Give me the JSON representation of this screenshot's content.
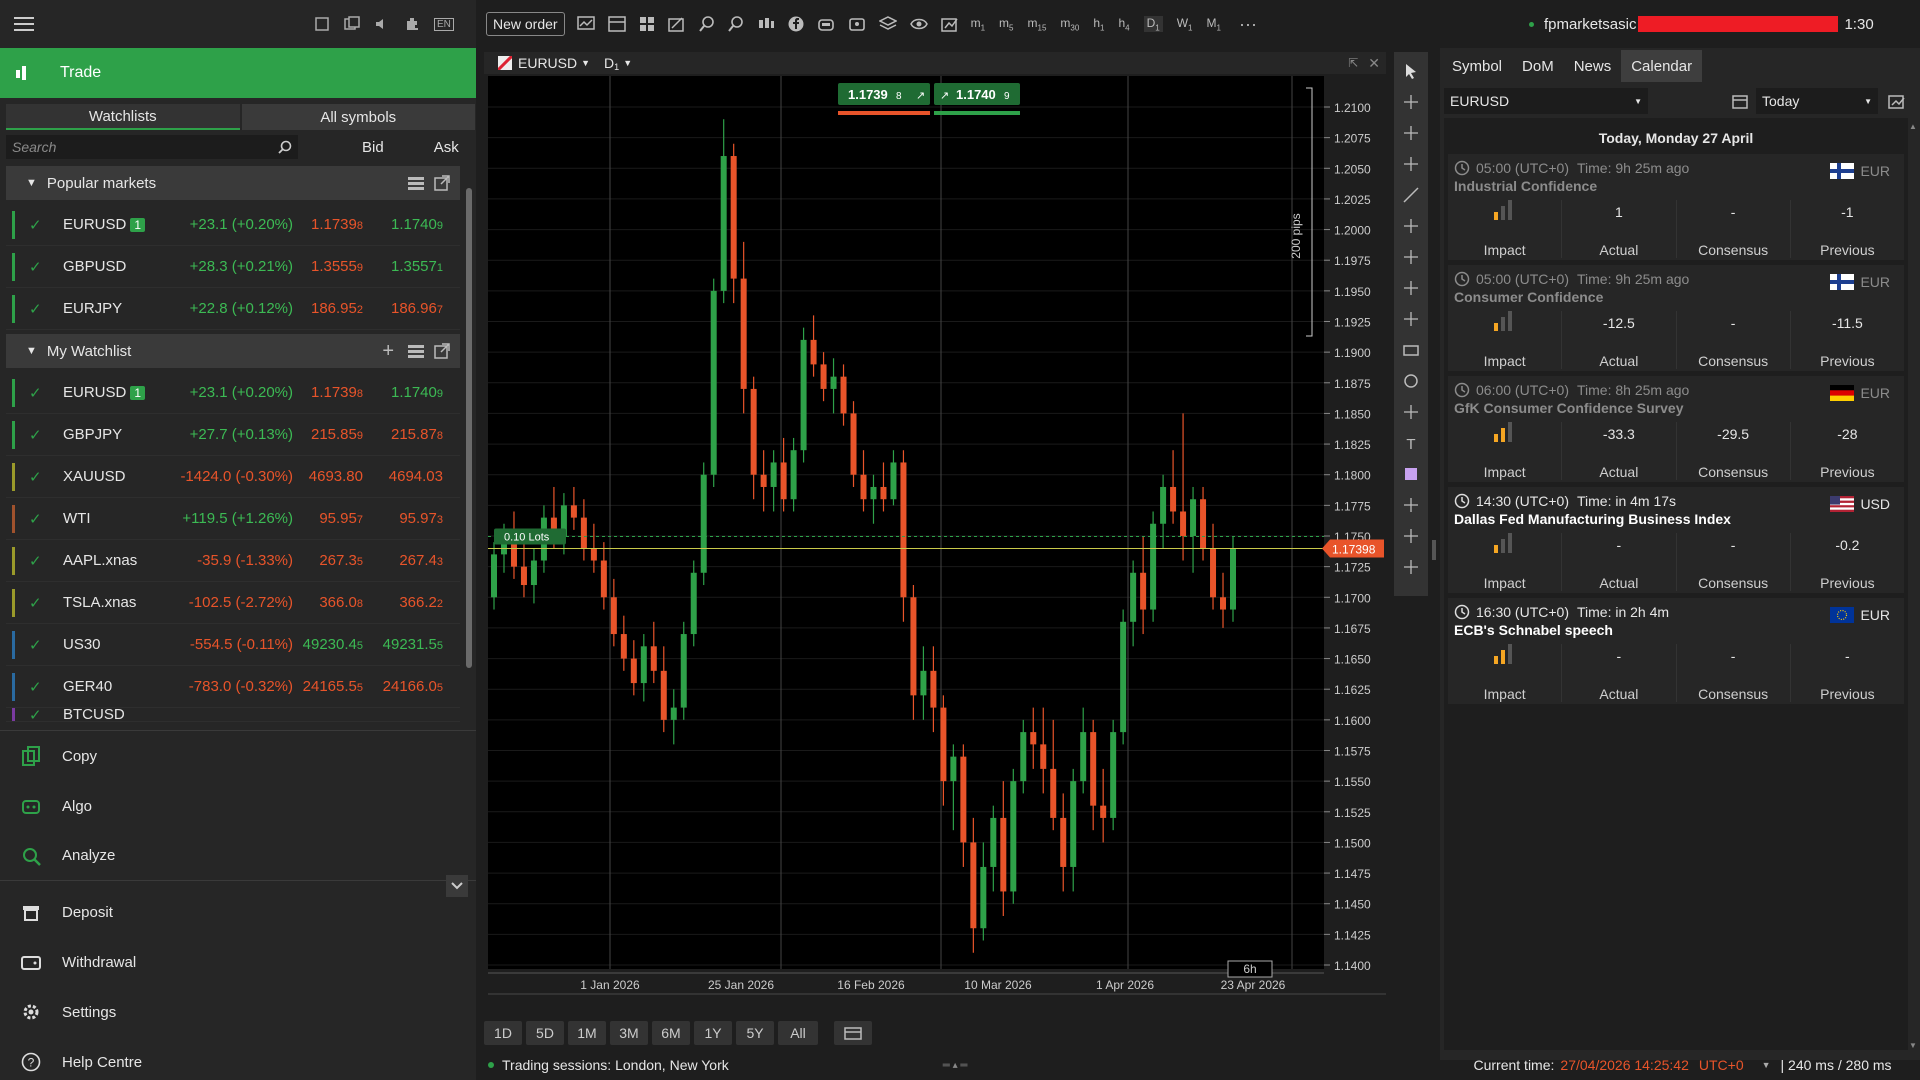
{
  "toolbar": {
    "new_order": "New order",
    "timeframes": [
      "m1",
      "m5",
      "m15",
      "m30",
      "h1",
      "h4",
      "D1",
      "W1",
      "M1"
    ],
    "user": "fpmarketsasic",
    "time": "1:30",
    "more": "···",
    "lang": "EN"
  },
  "left": {
    "trade": "Trade",
    "tab_watchlists": "Watchlists",
    "tab_all": "All symbols",
    "search_placeholder": "Search",
    "col_bid": "Bid",
    "col_ask": "Ask",
    "popular_title": "Popular markets",
    "mywatch_title": "My Watchlist",
    "popular": [
      {
        "sym": "EURUSD",
        "badge": "1",
        "chg": "+23.1 (+0.20%)",
        "bid": "1.1739",
        "bid_s": "8",
        "ask": "1.1740",
        "ask_s": "9",
        "dir": "up",
        "bar": "#2ea149",
        "bidc": "dn",
        "askc": "up"
      },
      {
        "sym": "GBPUSD",
        "badge": "",
        "chg": "+28.3 (+0.21%)",
        "bid": "1.3555",
        "bid_s": "9",
        "ask": "1.3557",
        "ask_s": "1",
        "dir": "up",
        "bar": "#2ea149",
        "bidc": "dn",
        "askc": "up"
      },
      {
        "sym": "EURJPY",
        "badge": "",
        "chg": "+22.8 (+0.12%)",
        "bid": "186.95",
        "bid_s": "2",
        "ask": "186.96",
        "ask_s": "7",
        "dir": "up",
        "bar": "#2ea149",
        "bidc": "dn",
        "askc": "dn"
      }
    ],
    "watch": [
      {
        "sym": "EURUSD",
        "badge": "1",
        "chg": "+23.1 (+0.20%)",
        "bid": "1.1739",
        "bid_s": "8",
        "ask": "1.1740",
        "ask_s": "9",
        "dir": "up",
        "bar": "#2ea149",
        "bidc": "dn",
        "askc": "up"
      },
      {
        "sym": "GBPJPY",
        "badge": "",
        "chg": "+27.7 (+0.13%)",
        "bid": "215.85",
        "bid_s": "9",
        "ask": "215.87",
        "ask_s": "8",
        "dir": "up",
        "bar": "#2ea149",
        "bidc": "dn",
        "askc": "dn"
      },
      {
        "sym": "XAUUSD",
        "badge": "",
        "chg": "-1424.0 (-0.30%)",
        "bid": "4693.80",
        "bid_s": "",
        "ask": "4694.03",
        "ask_s": "",
        "dir": "dn",
        "bar": "#9a9a2a",
        "bidc": "dn",
        "askc": "dn"
      },
      {
        "sym": "WTI",
        "badge": "",
        "chg": "+119.5 (+1.26%)",
        "bid": "95.95",
        "bid_s": "7",
        "ask": "95.97",
        "ask_s": "3",
        "dir": "up",
        "bar": "#a0522d",
        "bidc": "dn",
        "askc": "dn"
      },
      {
        "sym": "AAPL.xnas",
        "badge": "",
        "chg": "-35.9 (-1.33%)",
        "bid": "267.3",
        "bid_s": "5",
        "ask": "267.4",
        "ask_s": "3",
        "dir": "dn",
        "bar": "#9a9a2a",
        "bidc": "dn",
        "askc": "dn"
      },
      {
        "sym": "TSLA.xnas",
        "badge": "",
        "chg": "-102.5 (-2.72%)",
        "bid": "366.0",
        "bid_s": "8",
        "ask": "366.2",
        "ask_s": "2",
        "dir": "dn",
        "bar": "#9a9a2a",
        "bidc": "dn",
        "askc": "dn"
      },
      {
        "sym": "US30",
        "badge": "",
        "chg": "-554.5 (-0.11%)",
        "bid": "49230.4",
        "bid_s": "5",
        "ask": "49231.5",
        "ask_s": "5",
        "dir": "dn",
        "bar": "#2a6aa0",
        "bidc": "up",
        "askc": "up"
      },
      {
        "sym": "GER40",
        "badge": "",
        "chg": "-783.0 (-0.32%)",
        "bid": "24165.5",
        "bid_s": "5",
        "ask": "24166.0",
        "ask_s": "5",
        "dir": "dn",
        "bar": "#2a6aa0",
        "bidc": "dn",
        "askc": "dn"
      },
      {
        "sym": "BTCUSD",
        "badge": "",
        "chg": "",
        "bid": "",
        "bid_s": "",
        "ask": "",
        "ask_s": "",
        "dir": "up",
        "bar": "#7a3aa0",
        "bidc": "dn",
        "askc": "up"
      }
    ],
    "nav": [
      {
        "id": "copy",
        "label": "Copy",
        "icon": "copy-icon"
      },
      {
        "id": "algo",
        "label": "Algo",
        "icon": "robot-icon"
      },
      {
        "id": "analyze",
        "label": "Analyze",
        "icon": "analyze-icon"
      },
      {
        "id": "deposit",
        "label": "Deposit",
        "icon": "deposit-icon"
      },
      {
        "id": "withdrawal",
        "label": "Withdrawal",
        "icon": "wallet-icon"
      },
      {
        "id": "settings",
        "label": "Settings",
        "icon": "gear-icon"
      },
      {
        "id": "help",
        "label": "Help Centre",
        "icon": "help-icon"
      }
    ]
  },
  "chart": {
    "symbol": "EURUSD",
    "timeframe": "D",
    "timeframe_sub": "1",
    "sell_price": "1.1739",
    "sell_sub": "8",
    "buy_price": "1.1740",
    "buy_sub": "9",
    "pips_label": "200 pips",
    "lots_label": "0.10 Lots",
    "current_price": "1.17398",
    "countdown": "6h",
    "y_ticks": [
      "1.2100",
      "1.2075",
      "1.2050",
      "1.2025",
      "1.2000",
      "1.1975",
      "1.1950",
      "1.1925",
      "1.1900",
      "1.1875",
      "1.1850",
      "1.1825",
      "1.1800",
      "1.1775",
      "1.1750",
      "1.1725",
      "1.1700",
      "1.1675",
      "1.1650",
      "1.1625",
      "1.1600",
      "1.1575",
      "1.1550",
      "1.1525",
      "1.1500",
      "1.1475",
      "1.1450",
      "1.1425",
      "1.1400"
    ],
    "x_ticks": [
      "1 Jan 2026",
      "25 Jan 2026",
      "16 Feb 2026",
      "10 Mar 2026",
      "1 Apr 2026",
      "23 Apr 2026"
    ],
    "ranges": [
      "1D",
      "5D",
      "1M",
      "3M",
      "6M",
      "1Y",
      "5Y",
      "All"
    ],
    "sessions": "Trading sessions: London, New York"
  },
  "chart_data": {
    "type": "candlestick",
    "title": "EURUSD D1",
    "ylim": [
      1.14,
      1.21
    ],
    "candles": [
      [
        1.17,
        1.1745,
        1.169,
        1.1735
      ],
      [
        1.1735,
        1.176,
        1.172,
        1.1745
      ],
      [
        1.1745,
        1.177,
        1.1715,
        1.1725
      ],
      [
        1.1725,
        1.175,
        1.17,
        1.171
      ],
      [
        1.171,
        1.174,
        1.1695,
        1.173
      ],
      [
        1.173,
        1.1775,
        1.172,
        1.1765
      ],
      [
        1.1765,
        1.179,
        1.174,
        1.175
      ],
      [
        1.175,
        1.1785,
        1.1735,
        1.1775
      ],
      [
        1.1775,
        1.179,
        1.1755,
        1.1765
      ],
      [
        1.1765,
        1.178,
        1.173,
        1.174
      ],
      [
        1.174,
        1.176,
        1.172,
        1.173
      ],
      [
        1.173,
        1.1745,
        1.169,
        1.17
      ],
      [
        1.17,
        1.1715,
        1.166,
        1.167
      ],
      [
        1.167,
        1.1685,
        1.164,
        1.165
      ],
      [
        1.165,
        1.1665,
        1.162,
        1.163
      ],
      [
        1.163,
        1.167,
        1.1615,
        1.166
      ],
      [
        1.166,
        1.168,
        1.163,
        1.164
      ],
      [
        1.164,
        1.166,
        1.159,
        1.16
      ],
      [
        1.16,
        1.1625,
        1.158,
        1.161
      ],
      [
        1.161,
        1.168,
        1.16,
        1.167
      ],
      [
        1.167,
        1.173,
        1.166,
        1.172
      ],
      [
        1.172,
        1.181,
        1.171,
        1.18
      ],
      [
        1.18,
        1.196,
        1.179,
        1.195
      ],
      [
        1.195,
        1.209,
        1.194,
        1.206
      ],
      [
        1.206,
        1.207,
        1.194,
        1.196
      ],
      [
        1.196,
        1.199,
        1.185,
        1.187
      ],
      [
        1.187,
        1.188,
        1.178,
        1.18
      ],
      [
        1.18,
        1.182,
        1.177,
        1.179
      ],
      [
        1.179,
        1.182,
        1.177,
        1.181
      ],
      [
        1.181,
        1.183,
        1.177,
        1.178
      ],
      [
        1.178,
        1.183,
        1.177,
        1.182
      ],
      [
        1.182,
        1.192,
        1.181,
        1.191
      ],
      [
        1.191,
        1.193,
        1.188,
        1.189
      ],
      [
        1.189,
        1.19,
        1.186,
        1.187
      ],
      [
        1.187,
        1.1895,
        1.185,
        1.188
      ],
      [
        1.188,
        1.189,
        1.184,
        1.185
      ],
      [
        1.185,
        1.186,
        1.179,
        1.18
      ],
      [
        1.18,
        1.182,
        1.177,
        1.178
      ],
      [
        1.178,
        1.18,
        1.176,
        1.179
      ],
      [
        1.179,
        1.181,
        1.177,
        1.178
      ],
      [
        1.178,
        1.182,
        1.1775,
        1.181
      ],
      [
        1.181,
        1.182,
        1.168,
        1.17
      ],
      [
        1.17,
        1.171,
        1.16,
        1.162
      ],
      [
        1.162,
        1.166,
        1.16,
        1.164
      ],
      [
        1.164,
        1.166,
        1.159,
        1.161
      ],
      [
        1.161,
        1.162,
        1.153,
        1.155
      ],
      [
        1.155,
        1.158,
        1.151,
        1.157
      ],
      [
        1.157,
        1.158,
        1.148,
        1.15
      ],
      [
        1.15,
        1.152,
        1.141,
        1.143
      ],
      [
        1.143,
        1.15,
        1.142,
        1.148
      ],
      [
        1.148,
        1.153,
        1.146,
        1.152
      ],
      [
        1.152,
        1.155,
        1.144,
        1.146
      ],
      [
        1.146,
        1.156,
        1.145,
        1.155
      ],
      [
        1.155,
        1.16,
        1.154,
        1.159
      ],
      [
        1.159,
        1.161,
        1.156,
        1.158
      ],
      [
        1.158,
        1.161,
        1.154,
        1.156
      ],
      [
        1.156,
        1.16,
        1.151,
        1.152
      ],
      [
        1.152,
        1.154,
        1.146,
        1.148
      ],
      [
        1.148,
        1.156,
        1.146,
        1.155
      ],
      [
        1.155,
        1.161,
        1.154,
        1.159
      ],
      [
        1.159,
        1.16,
        1.151,
        1.153
      ],
      [
        1.153,
        1.156,
        1.15,
        1.152
      ],
      [
        1.152,
        1.16,
        1.151,
        1.159
      ],
      [
        1.159,
        1.169,
        1.158,
        1.168
      ],
      [
        1.168,
        1.173,
        1.166,
        1.172
      ],
      [
        1.172,
        1.175,
        1.167,
        1.169
      ],
      [
        1.169,
        1.177,
        1.168,
        1.176
      ],
      [
        1.176,
        1.18,
        1.174,
        1.179
      ],
      [
        1.179,
        1.182,
        1.176,
        1.177
      ],
      [
        1.177,
        1.185,
        1.173,
        1.175
      ],
      [
        1.175,
        1.179,
        1.172,
        1.178
      ],
      [
        1.178,
        1.179,
        1.173,
        1.174
      ],
      [
        1.174,
        1.176,
        1.169,
        1.17
      ],
      [
        1.17,
        1.172,
        1.1675,
        1.169
      ],
      [
        1.169,
        1.175,
        1.168,
        1.174
      ]
    ],
    "current_price": 1.17398
  },
  "right": {
    "tabs": [
      "Symbol",
      "DoM",
      "News",
      "Calendar"
    ],
    "symbol_select": "EURUSD",
    "date_select": "Today",
    "date_header": "Today, Monday 27 April",
    "events": [
      {
        "time": "05:00 (UTC+0)",
        "ago": "Time: 9h 25m ago",
        "title": "Industrial Confidence",
        "cur": "EUR",
        "flag": "fi",
        "impact": 1,
        "actual": "1",
        "consensus": "-",
        "previous": "-1",
        "past": true
      },
      {
        "time": "05:00 (UTC+0)",
        "ago": "Time: 9h 25m ago",
        "title": "Consumer Confidence",
        "cur": "EUR",
        "flag": "fi",
        "impact": 1,
        "actual": "-12.5",
        "consensus": "-",
        "previous": "-11.5",
        "past": true
      },
      {
        "time": "06:00 (UTC+0)",
        "ago": "Time: 8h 25m ago",
        "title": "GfK Consumer Confidence Survey",
        "cur": "EUR",
        "flag": "de",
        "impact": 2,
        "actual": "-33.3",
        "consensus": "-29.5",
        "previous": "-28",
        "past": true
      },
      {
        "time": "14:30 (UTC+0)",
        "ago": "Time:  in 4m 17s",
        "title": "Dallas Fed Manufacturing Business Index",
        "cur": "USD",
        "flag": "us",
        "impact": 1,
        "actual": "-",
        "consensus": "-",
        "previous": "-0.2",
        "past": false
      },
      {
        "time": "16:30 (UTC+0)",
        "ago": "Time:  in 2h 4m",
        "title": "ECB's Schnabel speech",
        "cur": "EUR",
        "flag": "eu",
        "impact": 2,
        "actual": "-",
        "consensus": "-",
        "previous": "-",
        "past": false
      }
    ],
    "labels": {
      "impact": "Impact",
      "actual": "Actual",
      "consensus": "Consensus",
      "previous": "Previous"
    }
  },
  "status": {
    "current_time_label": "Current time:",
    "current_time": "27/04/2026 14:25:42",
    "tz": "UTC+0",
    "latency": "| 240 ms / 280 ms"
  }
}
